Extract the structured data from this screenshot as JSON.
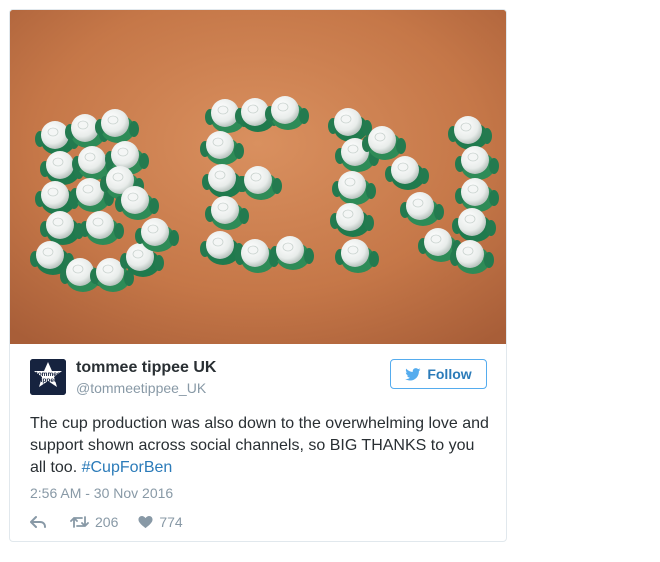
{
  "tweet": {
    "display_name": "tommee tippee UK",
    "handle": "@tommeetippee_UK",
    "avatar_text_line1": "tommee",
    "avatar_text_line2": "tippee",
    "follow_label": "Follow",
    "text_main": "The cup production was also down to the overwhelming love and support shown across social channels, so BIG THANKS to you all too. ",
    "hashtag": "#CupForBen",
    "timestamp": "2:56 AM - 30 Nov 2016",
    "retweet_count": "206",
    "like_count": "774"
  },
  "icons": {
    "reply": "reply-icon",
    "retweet": "retweet-icon",
    "like": "heart-icon",
    "follow": "twitter-bird-icon"
  },
  "colors": {
    "accent": "#2b7bb9",
    "muted": "#8899a6",
    "text": "#292f33",
    "border": "#e1e8ed",
    "carpet": "#c87a4e",
    "cup_green": "#2e8b57"
  }
}
